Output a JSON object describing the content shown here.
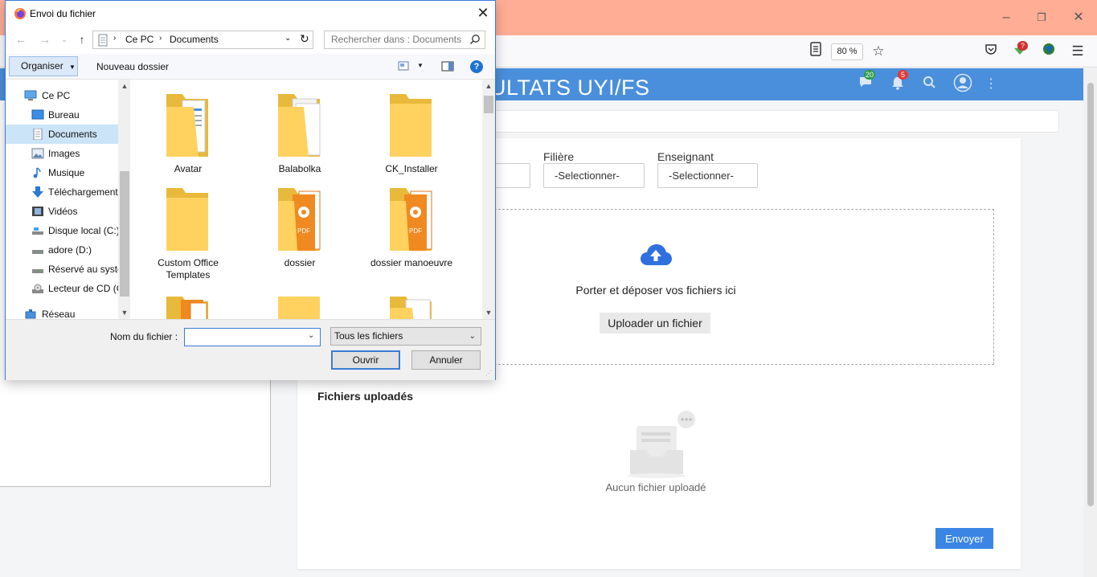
{
  "browser": {
    "zoom": "80 %",
    "chat_count": "20",
    "notif_count": "5",
    "download_badge": "?"
  },
  "app": {
    "title": "ULTATS UYI/FS",
    "filters": {
      "filiere_label": "Filière",
      "filiere_value": "-Selectionner-",
      "enseignant_label": "Enseignant",
      "enseignant_value": "-Selectionner-"
    },
    "dropzone": {
      "text": "Porter et déposer vos fichiers ici",
      "button": "Uploader un fichier"
    },
    "uploaded": {
      "title": "Fichiers uploadés",
      "empty": "Aucun fichier uploadé"
    },
    "send_button": "Envoyer",
    "colors": {
      "header": "#4a8fdc",
      "primary_button": "#3b86e4",
      "titlebar": "#ffad95"
    }
  },
  "dialog": {
    "title": "Envoi du fichier",
    "breadcrumb": [
      "Ce PC",
      "Documents"
    ],
    "search_placeholder": "Rechercher dans : Documents",
    "organiser": "Organiser",
    "new_folder": "Nouveau dossier",
    "nav": [
      {
        "label": "Ce PC",
        "icon": "computer-icon"
      },
      {
        "label": "Bureau",
        "icon": "desktop-icon"
      },
      {
        "label": "Documents",
        "icon": "documents-icon"
      },
      {
        "label": "Images",
        "icon": "images-icon"
      },
      {
        "label": "Musique",
        "icon": "music-icon"
      },
      {
        "label": "Téléchargements",
        "icon": "download-icon"
      },
      {
        "label": "Vidéos",
        "icon": "video-icon"
      },
      {
        "label": "Disque local (C:)",
        "icon": "drive-icon"
      },
      {
        "label": "adore (D:)",
        "icon": "drive-icon"
      },
      {
        "label": "Réservé au système",
        "icon": "drive-icon"
      },
      {
        "label": "Lecteur de CD (G:)",
        "icon": "cd-drive-icon"
      },
      {
        "label": "Réseau",
        "icon": "network-icon"
      }
    ],
    "files": [
      {
        "name": "Avatar",
        "icon": "folder-docs-icon"
      },
      {
        "name": "Balabolka",
        "icon": "folder-papers-icon"
      },
      {
        "name": "CK_Installer",
        "icon": "folder-icon"
      },
      {
        "name": "Custom Office Templates",
        "icon": "folder-icon"
      },
      {
        "name": "dossier",
        "icon": "folder-pdf-icon"
      },
      {
        "name": "dossier manoeuvre",
        "icon": "folder-pdf-icon"
      }
    ],
    "filename_label": "Nom du fichier :",
    "filename_value": "",
    "filetype": "Tous les fichiers",
    "open_button": "Ouvrir",
    "cancel_button": "Annuler"
  }
}
